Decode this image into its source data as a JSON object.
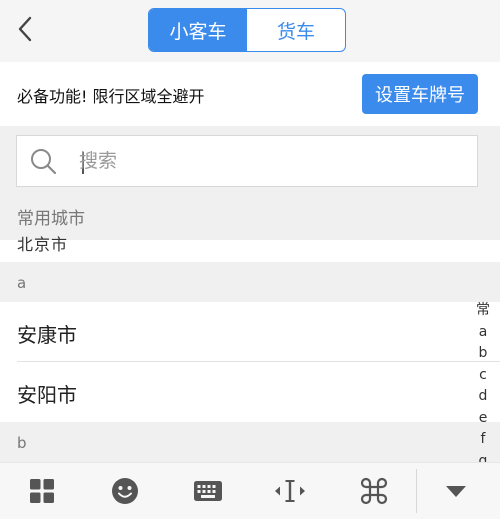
{
  "header": {
    "back_icon": "chevron-left-icon",
    "tabs": [
      {
        "label": "小客车",
        "active": true
      },
      {
        "label": "货车",
        "active": false
      }
    ]
  },
  "promo": {
    "text": "必备功能! 限行区域全避开",
    "button_label": "设置车牌号"
  },
  "search": {
    "icon": "search-icon",
    "placeholder": "搜索",
    "value": ""
  },
  "city_list": {
    "common_header": "常用城市",
    "sections": [
      {
        "letter": "a",
        "cities": [
          "安康市",
          "安阳市"
        ]
      },
      {
        "letter": "b",
        "cities": []
      }
    ]
  },
  "alpha_index": [
    "常",
    "a",
    "b",
    "c",
    "d",
    "e",
    "f",
    "g"
  ],
  "toolbar": {
    "icons": [
      "grid-icon",
      "emoji-icon",
      "keyboard-icon",
      "cursor-icon",
      "command-icon",
      "collapse-icon"
    ]
  },
  "colors": {
    "accent": "#3b8bec",
    "section_bg": "#f0f0f0",
    "toolbar_bg": "#f7f7f7"
  }
}
